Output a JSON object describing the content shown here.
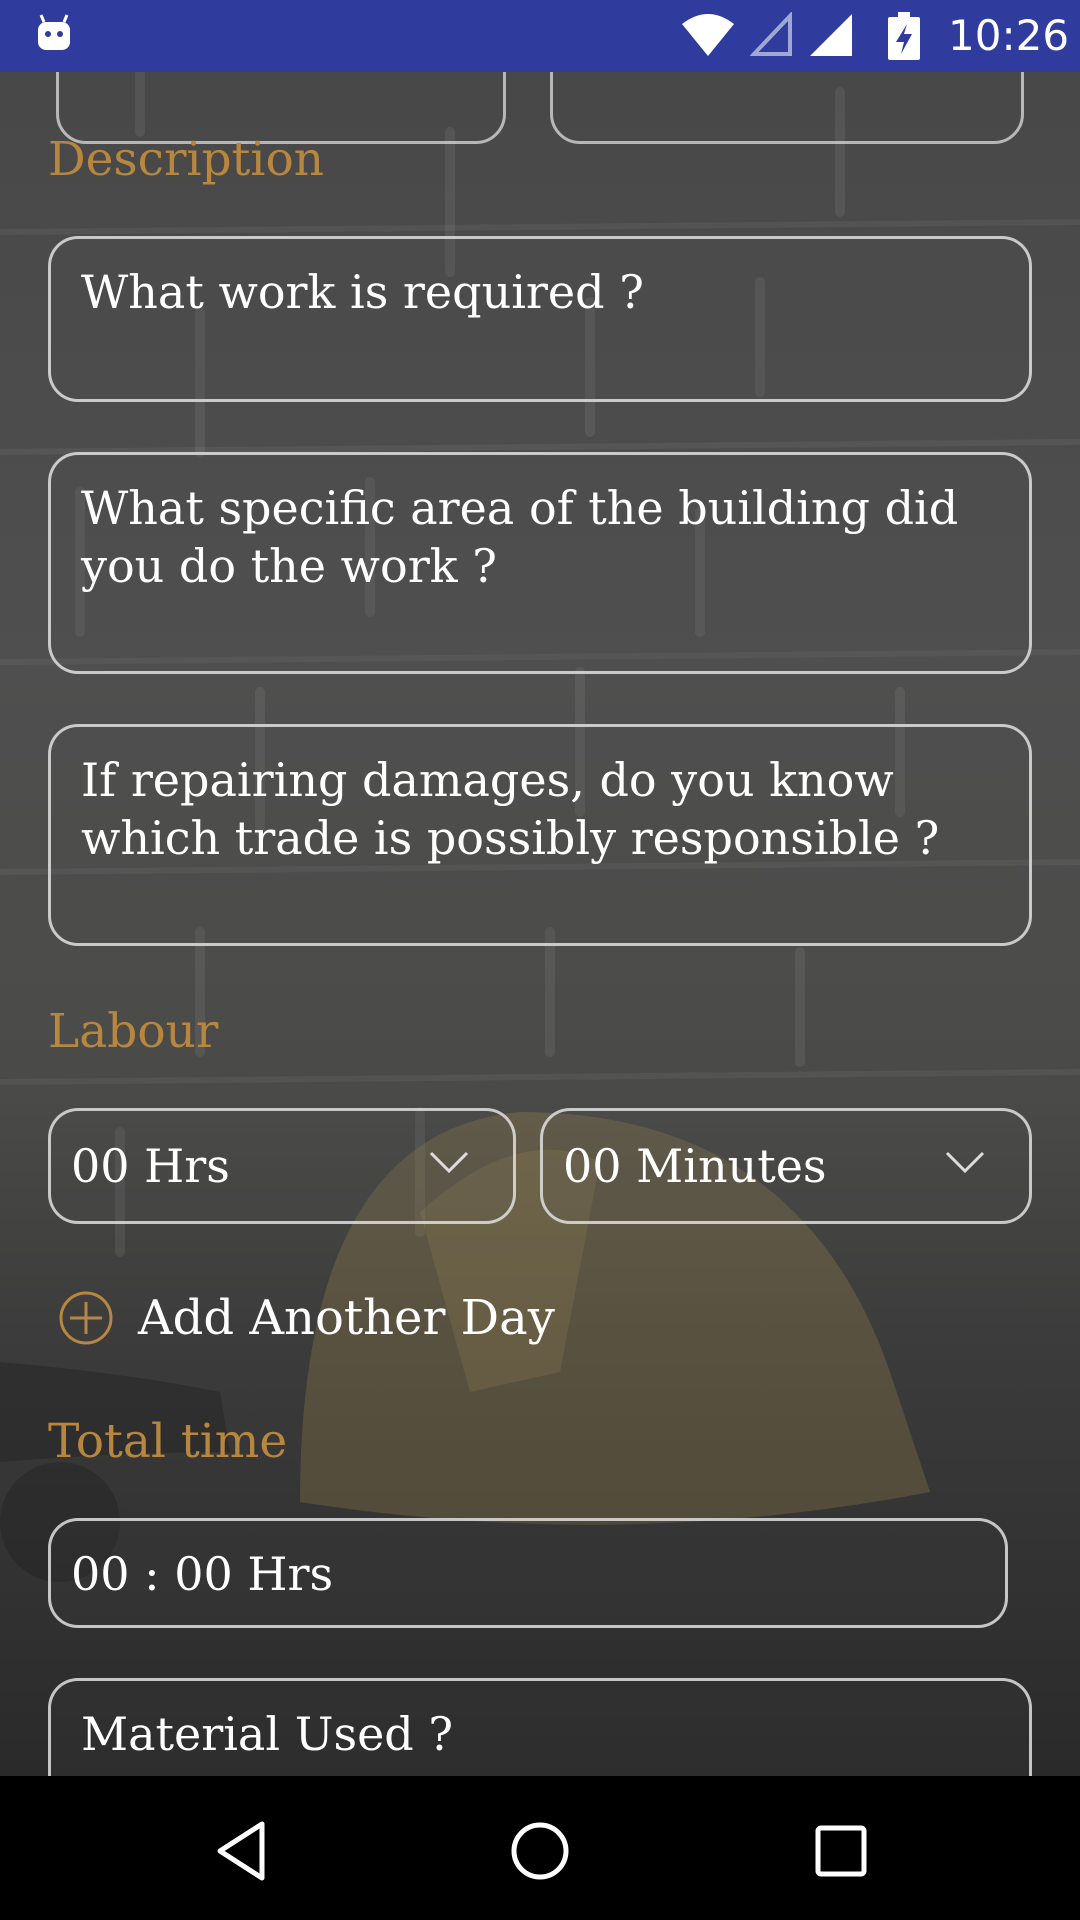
{
  "status_bar": {
    "time": "10:26",
    "icons": [
      "android-icon",
      "wifi-icon",
      "signal-empty-icon",
      "signal-icon",
      "battery-charging-icon"
    ]
  },
  "form": {
    "description_label": "Description",
    "work_required_placeholder": "What work is required ?",
    "specific_area_placeholder": "What specific area of the building did you do the work ?",
    "trade_responsible_placeholder": "If repairing damages, do you know which trade is possibly responsible ?",
    "labour_label": "Labour",
    "hours_value": "00 Hrs",
    "minutes_value": "00 Minutes",
    "add_day_label": "Add Another Day",
    "total_time_label": "Total time",
    "total_time_value": "00 : 00 Hrs",
    "material_placeholder": "Material Used ?"
  },
  "colors": {
    "status_bar": "#2f3c9e",
    "label_accent": "#b8873f",
    "text": "#ffffff"
  },
  "nav_bar": {
    "icons": [
      "back-icon",
      "home-icon",
      "recents-icon"
    ]
  }
}
